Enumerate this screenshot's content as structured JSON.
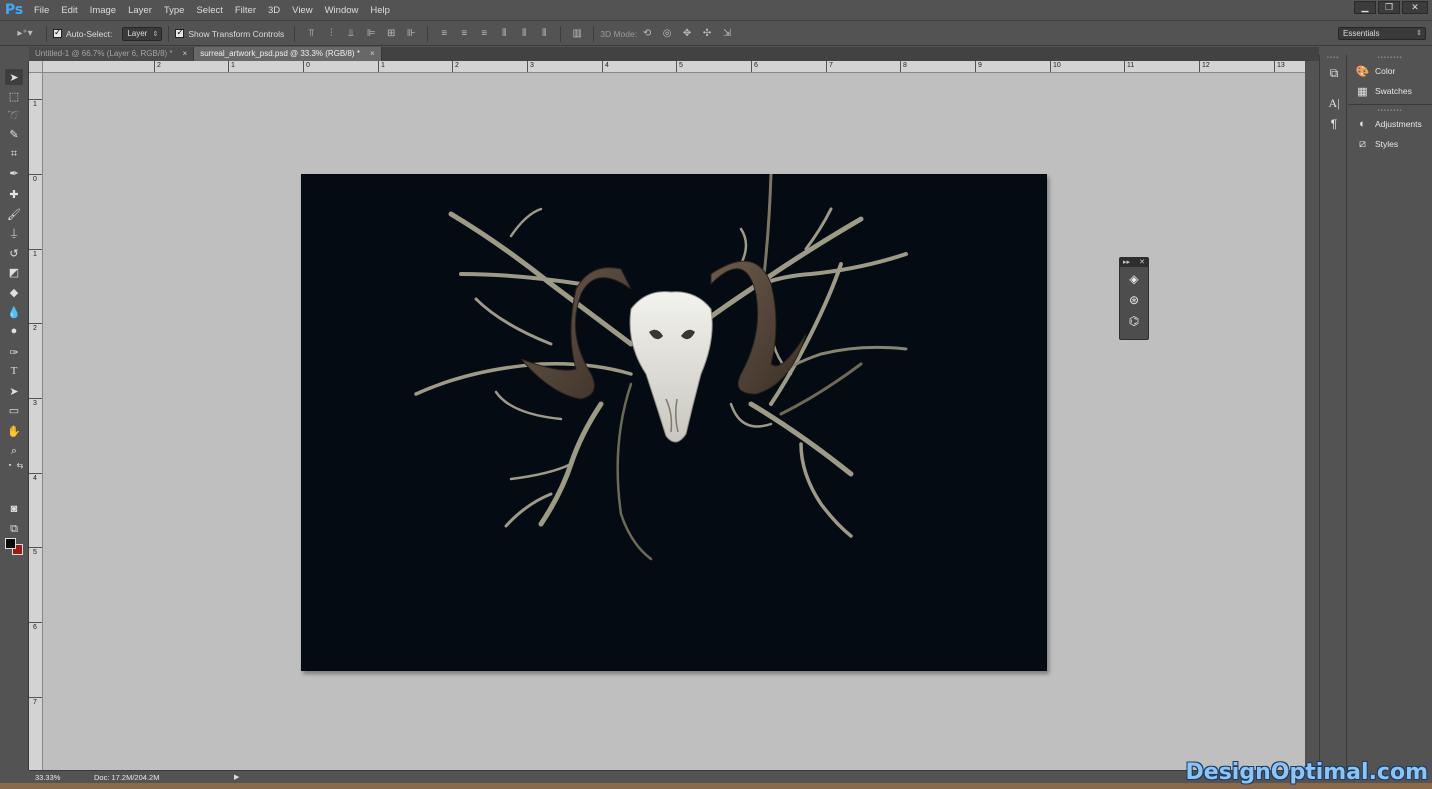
{
  "app": {
    "logo": "Ps"
  },
  "menu": [
    "File",
    "Edit",
    "Image",
    "Layer",
    "Type",
    "Select",
    "Filter",
    "3D",
    "View",
    "Window",
    "Help"
  ],
  "window_controls": {
    "minimize": "▁",
    "restore": "❐",
    "close": "✕"
  },
  "options": {
    "auto_select_label": "Auto-Select:",
    "auto_select_checked": true,
    "auto_select_target": "Layer",
    "show_transform_label": "Show Transform Controls",
    "show_transform_checked": true,
    "mode_3d_label": "3D Mode:",
    "workspace": "Essentials"
  },
  "tabs": [
    {
      "title": "Untitled-1 @ 66.7% (Layer 6, RGB/8) *",
      "active": false,
      "close": "×"
    },
    {
      "title": "surreal_artwork_psd.psd @ 33.3% (RGB/8) *",
      "active": true,
      "close": "×"
    }
  ],
  "ruler": {
    "top": [
      "2",
      "1",
      "0",
      "1",
      "2",
      "3",
      "4",
      "5",
      "6",
      "7",
      "8",
      "9",
      "10",
      "11",
      "12",
      "13"
    ],
    "left": [
      "1",
      "0",
      "1",
      "2",
      "3",
      "4",
      "5",
      "6",
      "7"
    ]
  },
  "status": {
    "zoom": "33.33%",
    "doc": "Doc: 17.2M/204.2M",
    "arrow": "▶"
  },
  "tools": [
    "move-tool",
    "marquee-tool",
    "lasso-tool",
    "quick-selection-tool",
    "crop-tool",
    "eyedropper-tool",
    "healing-brush-tool",
    "brush-tool",
    "clone-stamp-tool",
    "history-brush-tool",
    "eraser-tool",
    "paint-bucket-tool",
    "blur-tool",
    "dodge-tool",
    "pen-tool",
    "type-tool",
    "path-selection-tool",
    "rectangle-tool",
    "hand-tool",
    "zoom-tool"
  ],
  "colors": {
    "foreground": "#0a0a0a",
    "background": "#9c1b12",
    "canvas_bg": "#050b12"
  },
  "panels": {
    "group1": [
      "Color",
      "Swatches"
    ],
    "group2": [
      "Adjustments",
      "Styles"
    ]
  },
  "watermark": "DesignOptimal.com"
}
